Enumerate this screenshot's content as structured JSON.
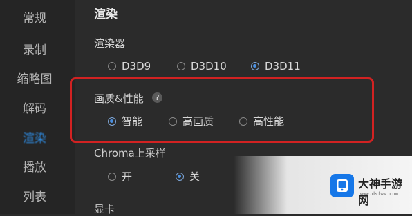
{
  "sidebar": {
    "items": [
      {
        "label": "常规"
      },
      {
        "label": "录制"
      },
      {
        "label": "缩略图"
      },
      {
        "label": "解码"
      },
      {
        "label": "渲染"
      },
      {
        "label": "播放"
      },
      {
        "label": "列表"
      }
    ],
    "active_index": 4,
    "active_color": "#2f8fe8"
  },
  "main": {
    "section_title": "渲染",
    "renderer": {
      "label": "渲染器",
      "options": [
        "D3D9",
        "D3D10",
        "D3D11"
      ],
      "selected": "D3D11"
    },
    "quality": {
      "label": "画质&性能",
      "help": "?",
      "options": [
        "智能",
        "高画质",
        "高性能"
      ],
      "selected": "智能"
    },
    "chroma": {
      "label": "Chroma上采样",
      "options": [
        "开",
        "关"
      ],
      "selected": "关"
    },
    "next_section_label": "显卡"
  },
  "highlight_color": "#d22222",
  "watermark": {
    "title": "大神手游网",
    "url": "www.dsfww.com",
    "brand_color": "#1677e8"
  }
}
